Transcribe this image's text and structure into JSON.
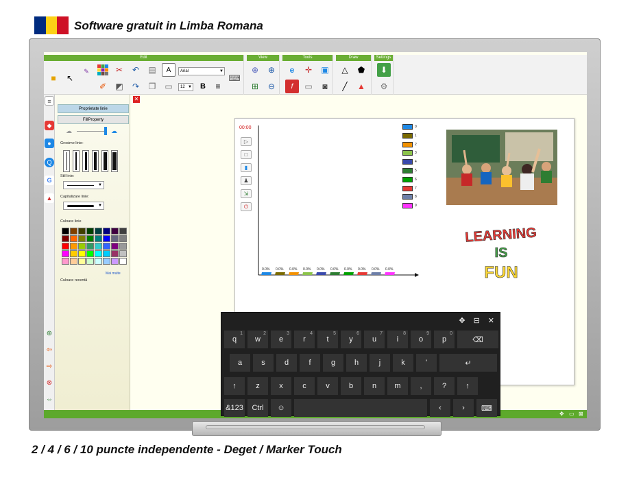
{
  "header": {
    "flag_colors": [
      "#002b7f",
      "#fcd116",
      "#ce1126"
    ],
    "title": "Software gratuit in Limba Romana"
  },
  "footer": {
    "caption": "2 / 4 / 6 / 10 puncte independente - Deget / Marker Touch"
  },
  "toolbar": {
    "groups": [
      {
        "title": "Edit"
      },
      {
        "title": "View"
      },
      {
        "title": "Tools"
      },
      {
        "title": "Draw"
      },
      {
        "title": "Settings"
      }
    ],
    "font_name": "Arial",
    "font_size": "12",
    "bold_label": "B",
    "text_tool_label": "A",
    "accent_color": "#6aae33"
  },
  "panel": {
    "tab_line_props": "Proprietate linie",
    "tab_fill_props": "FillProperty",
    "line_weight_label": "Grosime linie:",
    "line_style_label": "Stil linie:",
    "line_cap_label": "Capitalizare linie:",
    "line_color_label": "Culoare linie",
    "more_colors_label": "Mai multe",
    "recent_color_label": "Culoare recentă",
    "swatches": [
      "#000000",
      "#7f3f00",
      "#3f3f00",
      "#003f00",
      "#003f3f",
      "#00007f",
      "#3f003f",
      "#3f3f3f",
      "#7f0000",
      "#ff6600",
      "#7f7f00",
      "#007f00",
      "#007f7f",
      "#0000ff",
      "#66667f",
      "#7f7f7f",
      "#ff0000",
      "#ff9900",
      "#99cc00",
      "#339966",
      "#33cccc",
      "#3366ff",
      "#7f007f",
      "#999999",
      "#ff00ff",
      "#ffcc00",
      "#ffff00",
      "#00ff00",
      "#00ffff",
      "#00ccff",
      "#993366",
      "#c0c0c0",
      "#ff99cc",
      "#ffcc99",
      "#ffff99",
      "#ccffcc",
      "#ccffff",
      "#99ccff",
      "#cc99ff",
      "#ffffff"
    ]
  },
  "chart_data": {
    "type": "bar",
    "timer": "00:00",
    "categories": [
      "0",
      "1",
      "2",
      "3",
      "4",
      "5",
      "6",
      "7",
      "8",
      "9"
    ],
    "values": [
      0,
      0,
      0,
      0,
      0,
      0,
      0,
      0,
      0,
      0
    ],
    "value_labels": [
      "0.0%",
      "0.0%",
      "0.0%",
      "0.0%",
      "0.0%",
      "0.0%",
      "0.0%",
      "0.0%",
      "0.0%",
      "0.0%"
    ],
    "colors": [
      "#1e88e5",
      "#7a6a00",
      "#f29100",
      "#8bc34a",
      "#3949ab",
      "#2e7d32",
      "#00a000",
      "#e53935",
      "#6d7fa8",
      "#ff33ff"
    ],
    "legend": [
      "0",
      "1",
      "2",
      "3",
      "4",
      "5",
      "6",
      "7",
      "8",
      "9"
    ]
  },
  "artwork": {
    "learning_words": [
      "LEARNING",
      "IS",
      "FUN"
    ]
  },
  "keyboard": {
    "row1": [
      "q",
      "w",
      "e",
      "r",
      "t",
      "y",
      "u",
      "i",
      "o",
      "p",
      "⌫"
    ],
    "row1_hints": [
      "1",
      "2",
      "3",
      "4",
      "5",
      "6",
      "7",
      "8",
      "9",
      "0",
      ""
    ],
    "row2": [
      "a",
      "s",
      "d",
      "f",
      "g",
      "h",
      "j",
      "k",
      "'",
      "↵"
    ],
    "row3": [
      "↑",
      "z",
      "x",
      "c",
      "v",
      "b",
      "n",
      "m",
      ",",
      "?",
      "↑"
    ],
    "row4_left": [
      "&123",
      "Ctrl",
      "☺"
    ],
    "row4_right": [
      "‹",
      "›",
      "⌨"
    ],
    "top_icons": [
      "✥",
      "⊟",
      "✕"
    ]
  }
}
